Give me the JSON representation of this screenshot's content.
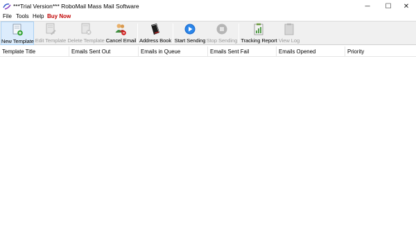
{
  "window": {
    "title": "***Trial Version*** RoboMail Mass Mail Software",
    "minimize": "─",
    "maximize": "☐",
    "close": "✕"
  },
  "menu": {
    "items": [
      "File",
      "Tools",
      "Help",
      "Buy Now"
    ]
  },
  "toolbar": {
    "buttons": [
      {
        "label": "New Template",
        "icon": "new-template-icon",
        "enabled": true
      },
      {
        "label": "Edit Template",
        "icon": "edit-template-icon",
        "enabled": false
      },
      {
        "label": "Delete Template",
        "icon": "delete-template-icon",
        "enabled": false
      },
      {
        "label": "Cancel Email",
        "icon": "cancel-email-icon",
        "enabled": true
      },
      {
        "label": "Address Book",
        "icon": "address-book-icon",
        "enabled": true
      },
      {
        "label": "Start Sending",
        "icon": "play-icon",
        "enabled": true
      },
      {
        "label": "Stop Sending",
        "icon": "stop-icon",
        "enabled": false
      },
      {
        "label": "Tracking Report",
        "icon": "report-icon",
        "enabled": true
      },
      {
        "label": "View Log",
        "icon": "clipboard-icon",
        "enabled": false
      }
    ]
  },
  "grid": {
    "columns": [
      "Template Title",
      "Emails Sent Out",
      "Emails in Queue",
      "Emails Sent Fail",
      "Emails Opened",
      "Priority"
    ]
  },
  "colors": {
    "accent_buy": "#c00000",
    "toolbar_bg": "#f0f0f0",
    "selected_bg": "#dcecfc"
  }
}
